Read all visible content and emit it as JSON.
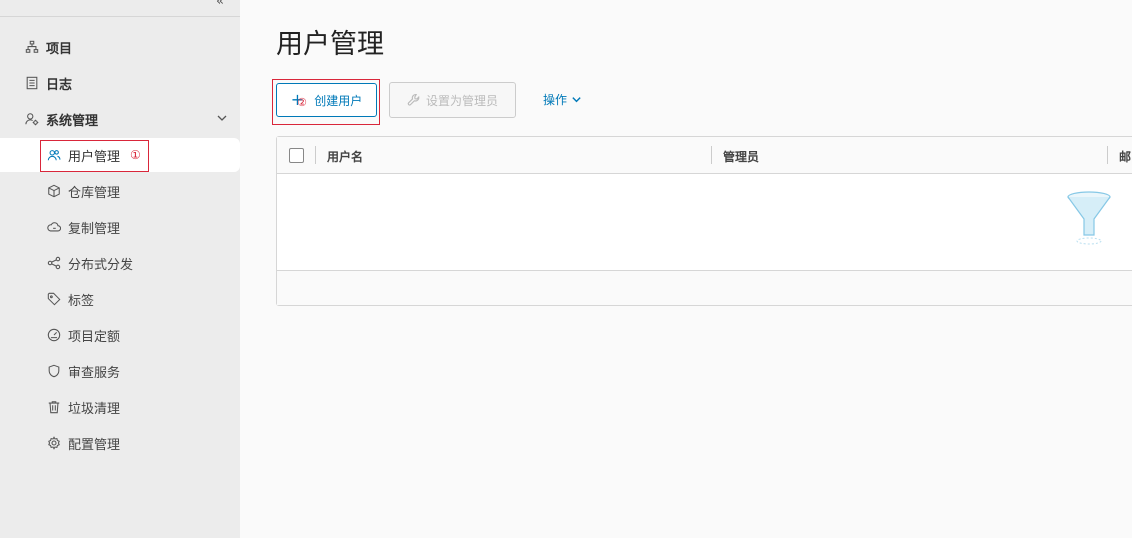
{
  "sidebar": {
    "collapse": "«",
    "items": [
      {
        "label": "项目",
        "icon": "sitemap-icon"
      },
      {
        "label": "日志",
        "icon": "log-icon"
      },
      {
        "label": "系统管理",
        "icon": "user-settings-icon"
      }
    ],
    "sub_items": [
      {
        "label": "用户管理",
        "icon": "users-icon"
      },
      {
        "label": "仓库管理",
        "icon": "cube-icon"
      },
      {
        "label": "复制管理",
        "icon": "cloud-icon"
      },
      {
        "label": "分布式分发",
        "icon": "share-icon"
      },
      {
        "label": "标签",
        "icon": "tag-icon"
      },
      {
        "label": "项目定额",
        "icon": "dashboard-icon"
      },
      {
        "label": "审查服务",
        "icon": "shield-icon"
      },
      {
        "label": "垃圾清理",
        "icon": "trash-icon"
      },
      {
        "label": "配置管理",
        "icon": "gear-icon"
      }
    ],
    "annotation_1": "①"
  },
  "main": {
    "title": "用户管理",
    "toolbar": {
      "create_label": "创建用户",
      "create_plus": "+",
      "annotation_2": "②",
      "admin_label": "设置为管理员",
      "ops_label": "操作"
    },
    "table": {
      "columns": [
        "用户名",
        "管理员",
        "邮"
      ]
    }
  },
  "colors": {
    "accent": "#0079b8",
    "annotation": "#d9263a",
    "sidebar_bg": "#ececec"
  }
}
